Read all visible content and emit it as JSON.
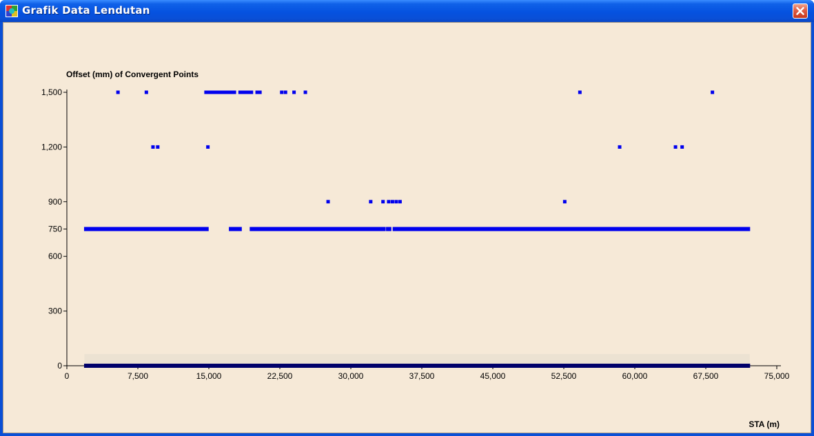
{
  "window": {
    "title": "Grafik Data Lendutan",
    "icon": "chart-app-icon",
    "close_icon": "close-icon",
    "client_background": "#f6e9d7",
    "titlebar_color": "#0a4fd6"
  },
  "chart_data": {
    "type": "scatter",
    "title": "",
    "ylabel": "Offset (mm) of Convergent Points",
    "xlabel": "STA (m)",
    "xlim": [
      0,
      75000
    ],
    "ylim": [
      0,
      1500
    ],
    "x_ticks": [
      0,
      7500,
      15000,
      22500,
      30000,
      37500,
      45000,
      52500,
      60000,
      67500,
      75000
    ],
    "x_tick_labels": [
      "0",
      "7,500",
      "15,000",
      "22,500",
      "30,000",
      "37,500",
      "45,000",
      "52,500",
      "60,000",
      "67,500",
      "75,000"
    ],
    "y_ticks": [
      0,
      300,
      600,
      750,
      900,
      1200,
      1500
    ],
    "y_tick_labels": [
      "0",
      "300",
      "600",
      "750",
      "900",
      "1,200",
      "1,500"
    ],
    "grid": false,
    "legend": "none",
    "marker_color": "#0000ee",
    "baseline_color": "#00006a",
    "series": [
      {
        "values_note": "",
        "points_1500": [
          5400,
          8400,
          14700,
          15000,
          15300,
          15600,
          15900,
          16200,
          16500,
          16800,
          17100,
          17400,
          17700,
          18300,
          18600,
          18900,
          19200,
          19500,
          20100,
          20400,
          22700,
          23100,
          24000,
          25200,
          54200,
          68200
        ],
        "points_1200": [
          9100,
          9600,
          14900,
          58400,
          64300,
          65000
        ],
        "points_900": [
          27600,
          32100,
          33400,
          34000,
          34400,
          34800,
          35200,
          52600
        ],
        "segments_750": [
          [
            2000,
            14800
          ],
          [
            17300,
            18300
          ],
          [
            19500,
            33500
          ],
          [
            33900,
            34100
          ],
          [
            34600,
            64900
          ],
          [
            65100,
            72000
          ]
        ],
        "segment_0": [
          2000,
          72000
        ]
      }
    ]
  }
}
